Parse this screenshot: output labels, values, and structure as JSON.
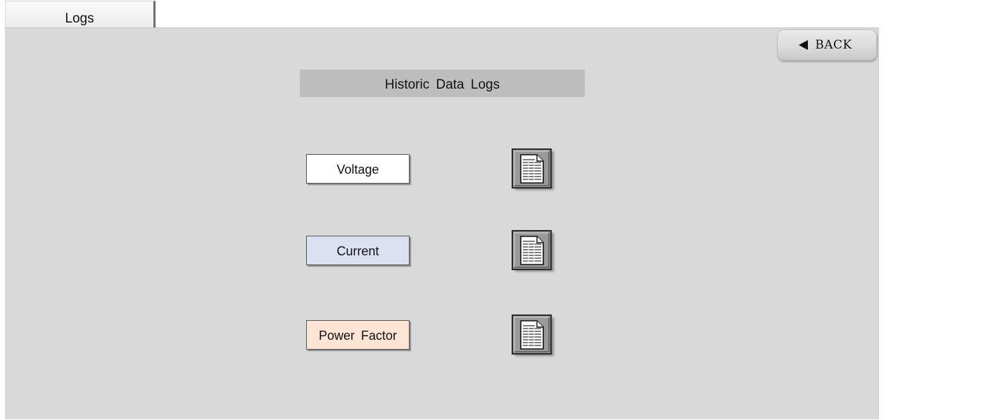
{
  "tab": {
    "label": "Logs"
  },
  "back_button": {
    "label": "BACK",
    "icon": "left-triangle-arrow"
  },
  "title": "Historic Data Logs",
  "log_buttons": [
    {
      "label": "Voltage",
      "color": "#ffffff",
      "icon": "document-icon"
    },
    {
      "label": "Current",
      "color": "#dce0f3",
      "icon": "document-icon"
    },
    {
      "label": "Power Factor",
      "color": "#fde4d4",
      "icon": "document-icon"
    }
  ],
  "colors": {
    "panel": "#d9d9d9",
    "title_bar": "#bdbdbd"
  }
}
